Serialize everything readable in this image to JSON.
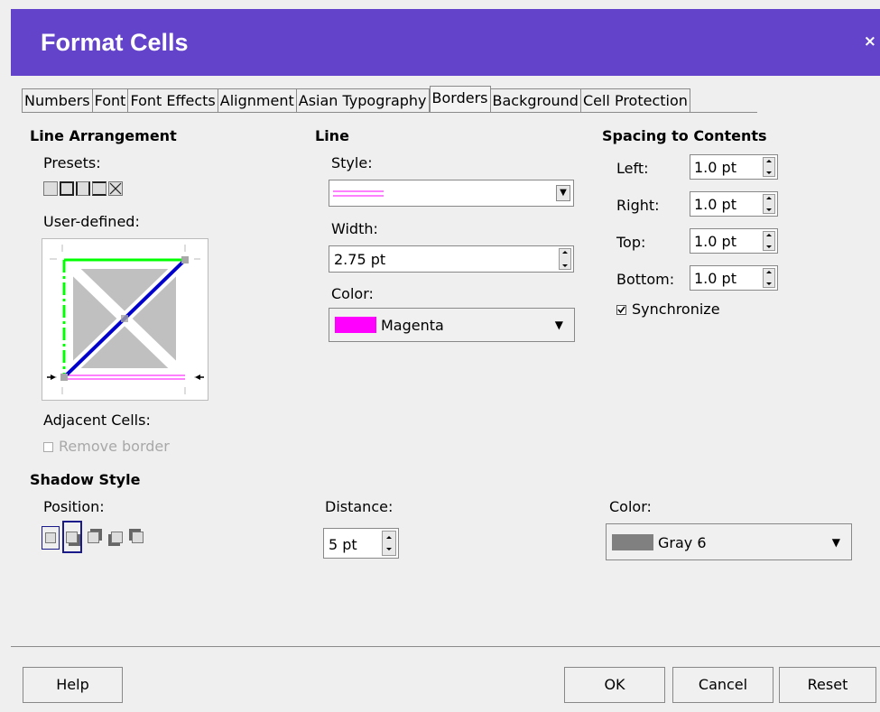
{
  "window": {
    "title": "Format Cells",
    "close_glyph": "×"
  },
  "tabs": [
    {
      "label": "Numbers"
    },
    {
      "label": "Font"
    },
    {
      "label": "Font Effects"
    },
    {
      "label": "Alignment"
    },
    {
      "label": "Asian Typography"
    },
    {
      "label": "Borders",
      "active": true
    },
    {
      "label": "Background"
    },
    {
      "label": "Cell Protection"
    }
  ],
  "line_arrangement": {
    "heading": "Line Arrangement",
    "presets_label": "Presets:",
    "user_defined_label": "User-defined:",
    "adjacent_cells_label": "Adjacent Cells:",
    "remove_border_label": "Remove border",
    "remove_border_checked": false
  },
  "line": {
    "heading": "Line",
    "style_label": "Style:",
    "width_label": "Width:",
    "width_value": "2.75 pt",
    "color_label": "Color:",
    "color_value": "Magenta",
    "color_hex": "#ff00ff"
  },
  "spacing": {
    "heading": "Spacing to Contents",
    "left_label": "Left:",
    "left_value": "1.0 pt",
    "right_label": "Right:",
    "right_value": "1.0 pt",
    "top_label": "Top:",
    "top_value": "1.0 pt",
    "bottom_label": "Bottom:",
    "bottom_value": "1.0 pt",
    "synchronize_label": "Synchronize",
    "synchronize_checked": true
  },
  "shadow": {
    "heading": "Shadow Style",
    "position_label": "Position:",
    "distance_label": "Distance:",
    "distance_value": "5 pt",
    "color_label": "Color:",
    "color_value": "Gray 6",
    "color_hex": "#808080"
  },
  "buttons": {
    "help": "Help",
    "ok": "OK",
    "cancel": "Cancel",
    "reset": "Reset"
  },
  "colors": {
    "titlebar": "#6243c9",
    "green_line": "#00ff00",
    "blue_line": "#0000cc",
    "magenta": "#ff00ff"
  }
}
